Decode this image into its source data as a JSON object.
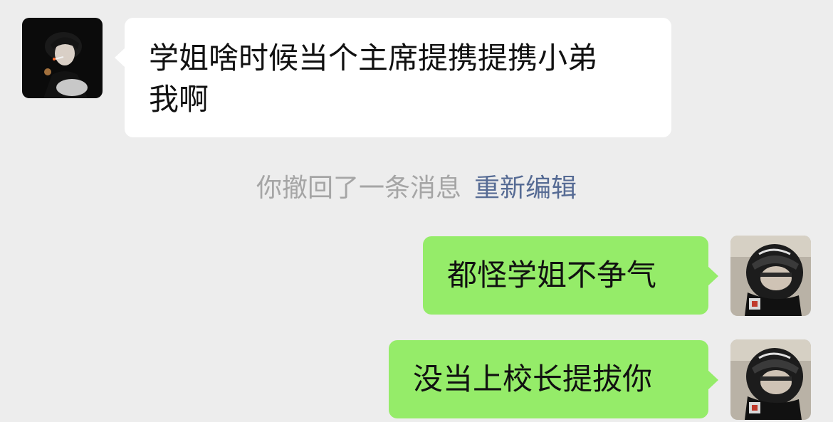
{
  "messages": [
    {
      "side": "left",
      "avatar": "avatar-dark-portrait",
      "lines": [
        "学姐啥时候当个主席提携提携小弟",
        "我啊"
      ]
    },
    {
      "side": "right",
      "avatar": "avatar-helmet-portrait",
      "text": "都怪学姐不争气"
    },
    {
      "side": "right",
      "avatar": "avatar-helmet-portrait",
      "text": "没当上校长提拔你"
    }
  ],
  "system_notice": {
    "text": "你撤回了一条消息",
    "reedit_label": "重新编辑"
  },
  "colors": {
    "background": "#ededed",
    "incoming_bubble": "#ffffff",
    "outgoing_bubble": "#95ec69",
    "notice_text": "#a5a5a5",
    "reedit_link": "#566b94"
  }
}
